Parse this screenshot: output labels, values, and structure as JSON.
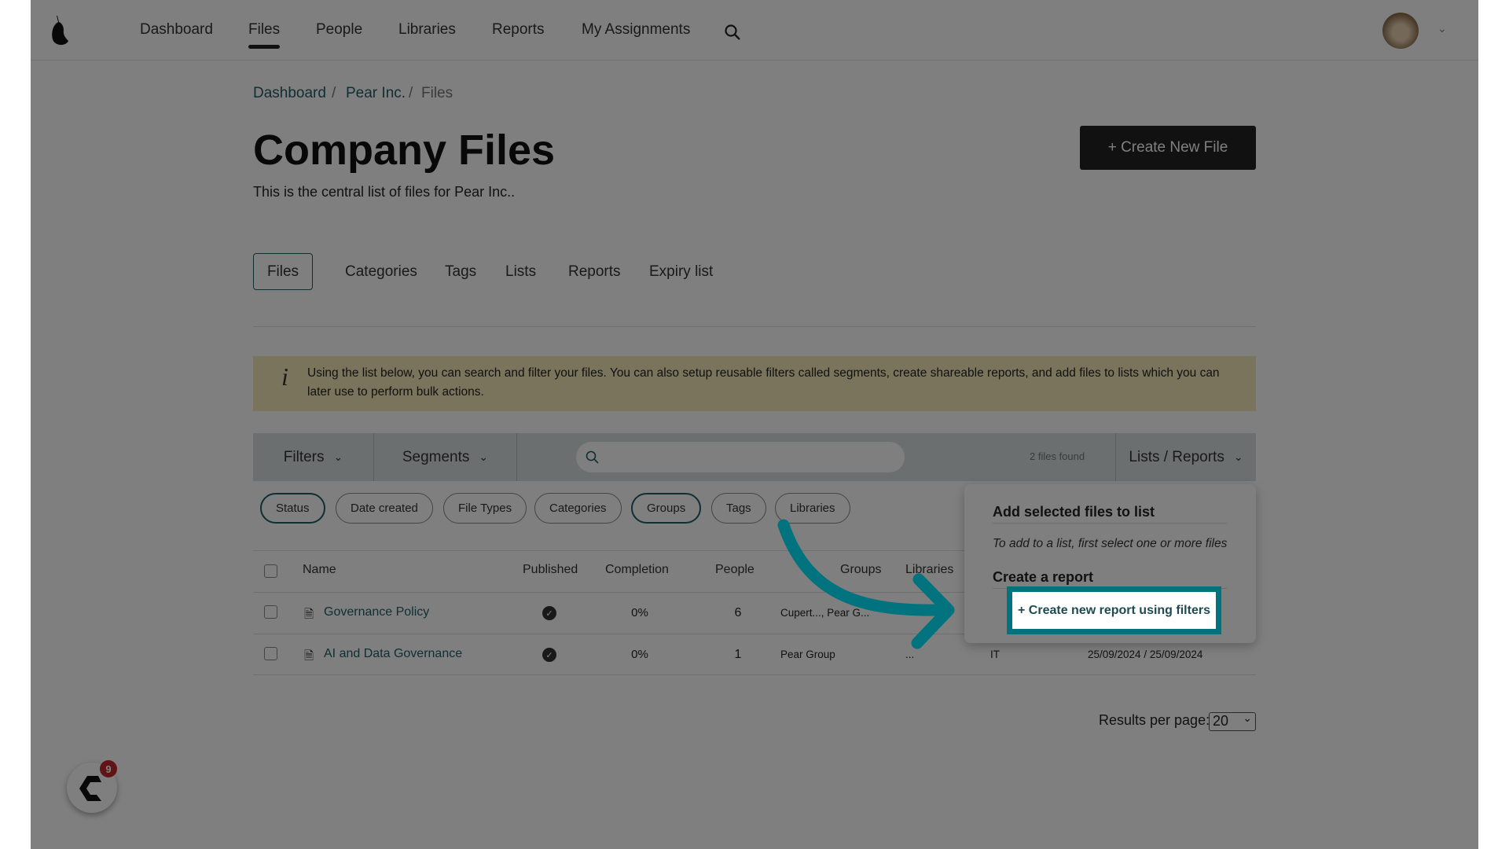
{
  "nav": {
    "items": [
      {
        "label": "Dashboard"
      },
      {
        "label": "Files",
        "active": true
      },
      {
        "label": "People"
      },
      {
        "label": "Libraries"
      },
      {
        "label": "Reports"
      },
      {
        "label": "My Assignments"
      }
    ]
  },
  "breadcrumb": [
    "Dashboard",
    "Pear Inc.",
    "Files"
  ],
  "page": {
    "title": "Company Files",
    "subtitle": "This is the central list of files for Pear Inc..",
    "create_button": "+ Create New File"
  },
  "tabs": [
    "Files",
    "Categories",
    "Tags",
    "Lists",
    "Reports",
    "Expiry list"
  ],
  "info": "Using the list below, you can search and filter your files. You can also setup reusable filters called segments, create shareable reports, and add files to lists which you can later use to perform bulk actions.",
  "toolbar": {
    "filters": "Filters",
    "segments": "Segments",
    "search_value": "",
    "count": "2 files found",
    "lists_reports": "Lists / Reports"
  },
  "chips": [
    {
      "label": "Status",
      "selected": true
    },
    {
      "label": "Date created"
    },
    {
      "label": "File Types"
    },
    {
      "label": "Categories"
    },
    {
      "label": "Groups",
      "selected": true
    },
    {
      "label": "Tags"
    },
    {
      "label": "Libraries"
    }
  ],
  "table": {
    "headers": [
      "Name",
      "Published",
      "Completion",
      "People",
      "Groups",
      "Libraries"
    ],
    "rows": [
      {
        "name": "Governance Policy",
        "published": true,
        "completion": "0%",
        "people": "6",
        "groups": "Cupert..., Pear G...",
        "libraries": "...",
        "extra": "",
        "dates": ""
      },
      {
        "name": "AI and Data Governance",
        "published": true,
        "completion": "0%",
        "people": "1",
        "groups": "Pear Group",
        "libraries": "...",
        "extra": "IT",
        "dates": "25/09/2024 / 25/09/2024"
      }
    ]
  },
  "dropdown": {
    "list_heading": "Add selected files to list",
    "list_hint": "To add to a list, first select one or more files",
    "report_heading": "Create a report",
    "report_button": "+ Create new report using filters"
  },
  "pagination": {
    "label": "Results per page:",
    "value": "20"
  },
  "widget": {
    "badge": "9"
  },
  "colors": {
    "accent": "#00737f",
    "link": "#1f5e66",
    "badge": "#c0282b"
  }
}
